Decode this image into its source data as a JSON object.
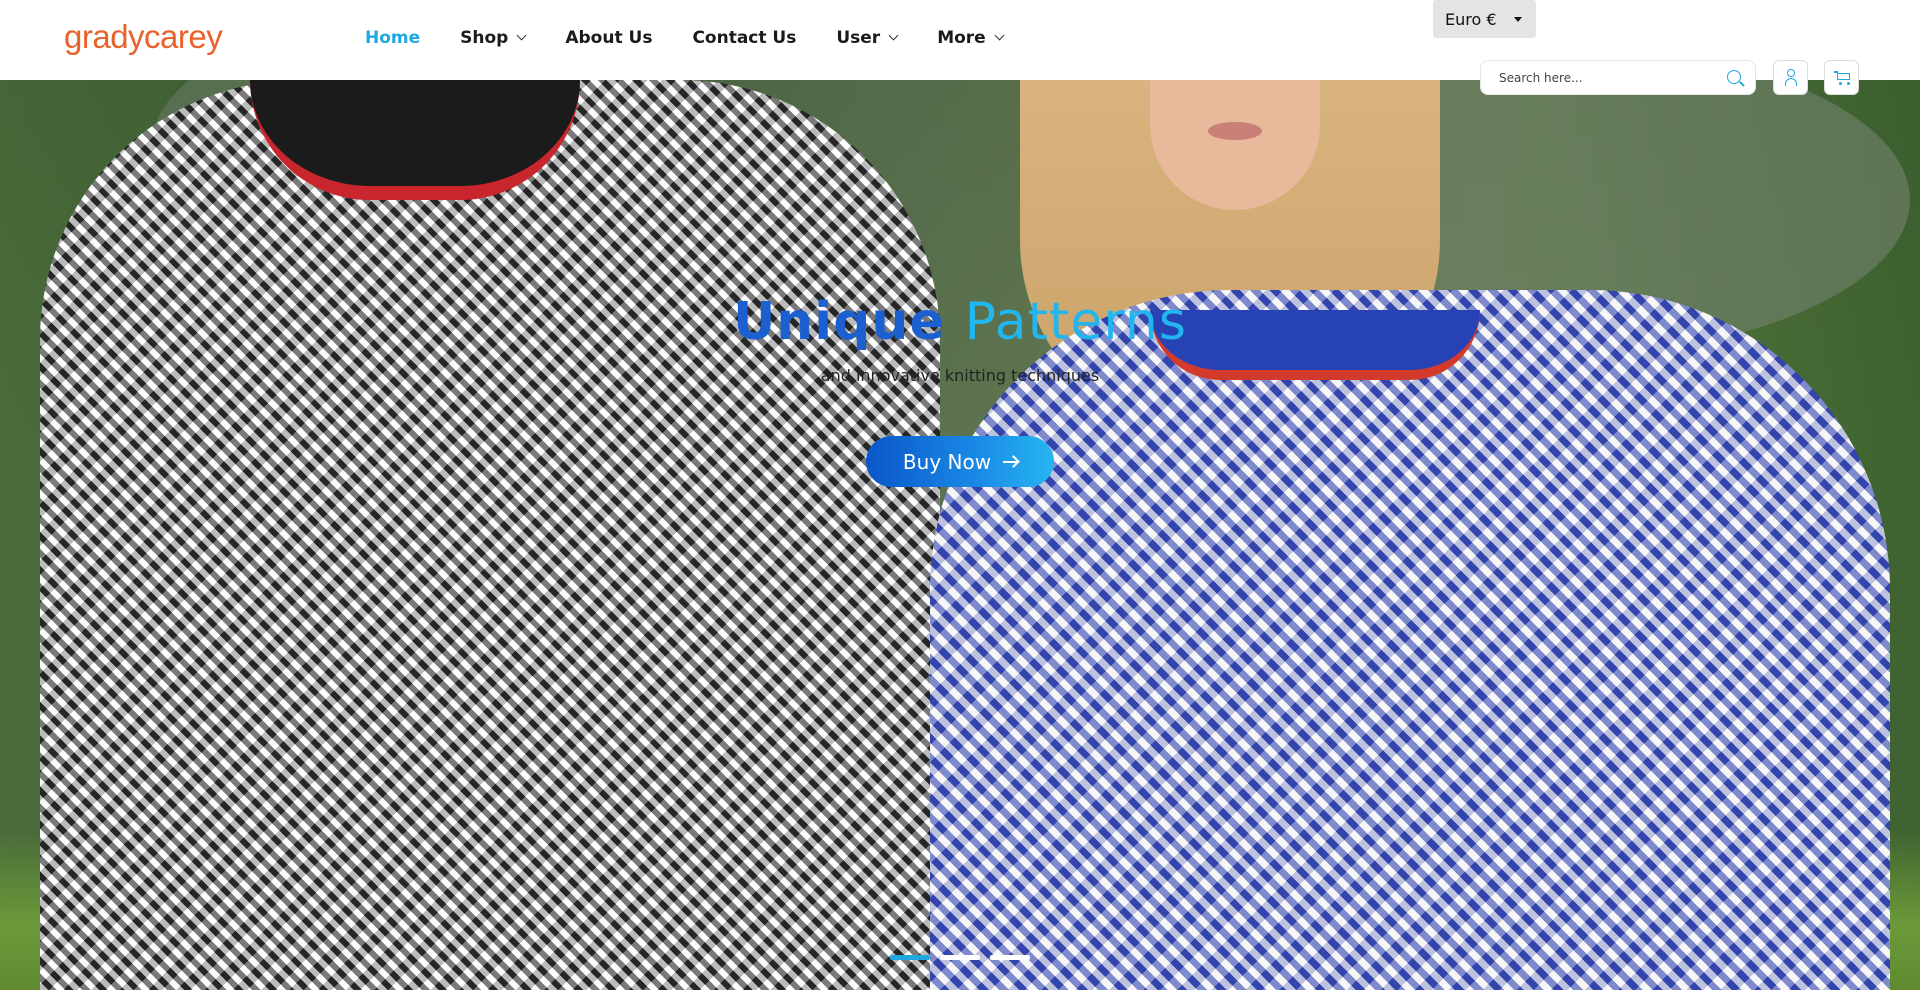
{
  "brand": {
    "logo_text": "gradycarey",
    "color": "#e8632c"
  },
  "nav": {
    "items": [
      {
        "label": "Home",
        "active": true,
        "dropdown": false
      },
      {
        "label": "Shop",
        "active": false,
        "dropdown": true
      },
      {
        "label": "About Us",
        "active": false,
        "dropdown": false
      },
      {
        "label": "Contact Us",
        "active": false,
        "dropdown": false
      },
      {
        "label": "User",
        "active": false,
        "dropdown": true
      },
      {
        "label": "More",
        "active": false,
        "dropdown": true
      }
    ],
    "active_color": "#1fa8e0"
  },
  "currency": {
    "selected": "Euro €"
  },
  "search": {
    "placeholder": "Search here...",
    "value": ""
  },
  "icons": {
    "search": "search-icon",
    "user": "user-icon",
    "cart": "cart-icon"
  },
  "hero": {
    "title_word1": "Unique",
    "title_word2": "Patterns",
    "subtitle": "and innovative knitting techniques",
    "cta_label": "Buy Now",
    "colors": {
      "title_dark": "#1c5fcf",
      "title_light": "#21b6ef",
      "button": "#0a56c9"
    }
  },
  "carousel": {
    "slide_count": 3,
    "active_index": 0
  }
}
